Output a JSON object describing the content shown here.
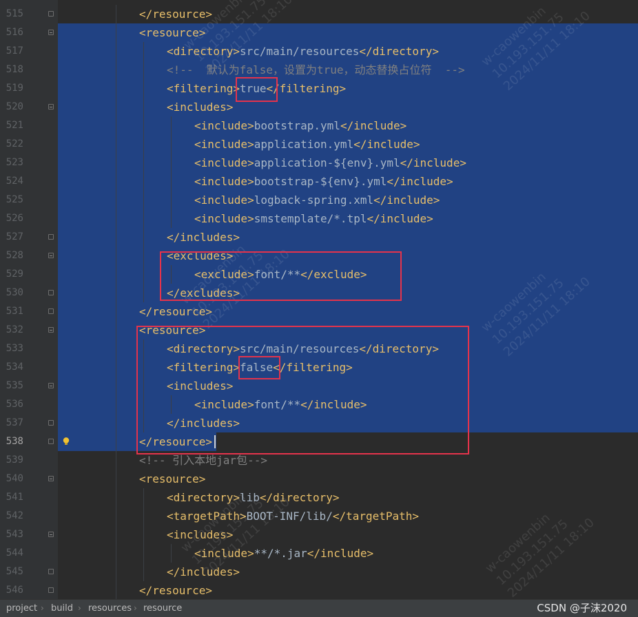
{
  "editor": {
    "lines": [
      {
        "num": "515",
        "indent": 3,
        "parts": [
          [
            "tag",
            "</resource>"
          ]
        ],
        "sel": false,
        "fold": "close"
      },
      {
        "num": "516",
        "indent": 3,
        "parts": [
          [
            "tag",
            "<resource>"
          ]
        ],
        "sel": true,
        "fold": "open"
      },
      {
        "num": "517",
        "indent": 4,
        "parts": [
          [
            "tag",
            "<directory>"
          ],
          [
            "txt",
            "src/main/resources"
          ],
          [
            "tag",
            "</directory>"
          ]
        ],
        "sel": true
      },
      {
        "num": "518",
        "indent": 4,
        "parts": [
          [
            "cmt",
            "<!--  默认为false，设置为true，动态替换占位符  -->"
          ]
        ],
        "sel": true
      },
      {
        "num": "519",
        "indent": 4,
        "parts": [
          [
            "tag",
            "<filtering>"
          ],
          [
            "txt",
            "true"
          ],
          [
            "tag",
            "</filtering>"
          ]
        ],
        "sel": true
      },
      {
        "num": "520",
        "indent": 4,
        "parts": [
          [
            "tag",
            "<includes>"
          ]
        ],
        "sel": true,
        "fold": "open"
      },
      {
        "num": "521",
        "indent": 5,
        "parts": [
          [
            "tag",
            "<include>"
          ],
          [
            "txt",
            "bootstrap.yml"
          ],
          [
            "tag",
            "</include>"
          ]
        ],
        "sel": true
      },
      {
        "num": "522",
        "indent": 5,
        "parts": [
          [
            "tag",
            "<include>"
          ],
          [
            "txt",
            "application.yml"
          ],
          [
            "tag",
            "</include>"
          ]
        ],
        "sel": true
      },
      {
        "num": "523",
        "indent": 5,
        "parts": [
          [
            "tag",
            "<include>"
          ],
          [
            "txt",
            "application-${env}.yml"
          ],
          [
            "tag",
            "</include>"
          ]
        ],
        "sel": true
      },
      {
        "num": "524",
        "indent": 5,
        "parts": [
          [
            "tag",
            "<include>"
          ],
          [
            "txt",
            "bootstrap-${env}.yml"
          ],
          [
            "tag",
            "</include>"
          ]
        ],
        "sel": true
      },
      {
        "num": "525",
        "indent": 5,
        "parts": [
          [
            "tag",
            "<include>"
          ],
          [
            "txt",
            "logback-spring.xml"
          ],
          [
            "tag",
            "</include>"
          ]
        ],
        "sel": true
      },
      {
        "num": "526",
        "indent": 5,
        "parts": [
          [
            "tag",
            "<include>"
          ],
          [
            "txt",
            "smstemplate/*.tpl"
          ],
          [
            "tag",
            "</include>"
          ]
        ],
        "sel": true
      },
      {
        "num": "527",
        "indent": 4,
        "parts": [
          [
            "tag",
            "</includes>"
          ]
        ],
        "sel": true,
        "fold": "close"
      },
      {
        "num": "528",
        "indent": 4,
        "parts": [
          [
            "tag",
            "<excludes>"
          ]
        ],
        "sel": true,
        "fold": "open"
      },
      {
        "num": "529",
        "indent": 5,
        "parts": [
          [
            "tag",
            "<exclude>"
          ],
          [
            "txt",
            "font/**"
          ],
          [
            "tag",
            "</exclude>"
          ]
        ],
        "sel": true
      },
      {
        "num": "530",
        "indent": 4,
        "parts": [
          [
            "tag",
            "</excludes>"
          ]
        ],
        "sel": true,
        "fold": "close"
      },
      {
        "num": "531",
        "indent": 3,
        "parts": [
          [
            "tag",
            "</resource>"
          ]
        ],
        "sel": true,
        "fold": "close"
      },
      {
        "num": "532",
        "indent": 3,
        "parts": [
          [
            "tag",
            "<resource>"
          ]
        ],
        "sel": true,
        "fold": "open"
      },
      {
        "num": "533",
        "indent": 4,
        "parts": [
          [
            "tag",
            "<directory>"
          ],
          [
            "txt",
            "src/main/resources"
          ],
          [
            "tag",
            "</directory>"
          ]
        ],
        "sel": true
      },
      {
        "num": "534",
        "indent": 4,
        "parts": [
          [
            "tag",
            "<filtering>"
          ],
          [
            "txt",
            "false"
          ],
          [
            "tag",
            "</filtering>"
          ]
        ],
        "sel": true
      },
      {
        "num": "535",
        "indent": 4,
        "parts": [
          [
            "tag",
            "<includes>"
          ]
        ],
        "sel": true,
        "fold": "open"
      },
      {
        "num": "536",
        "indent": 5,
        "parts": [
          [
            "tag",
            "<include>"
          ],
          [
            "txt",
            "font/**"
          ],
          [
            "tag",
            "</include>"
          ]
        ],
        "sel": true
      },
      {
        "num": "537",
        "indent": 4,
        "parts": [
          [
            "tag",
            "</includes>"
          ]
        ],
        "sel": true,
        "fold": "close"
      },
      {
        "num": "538",
        "indent": 3,
        "parts": [
          [
            "tag",
            "</resource>"
          ]
        ],
        "sel": "partial",
        "fold": "close",
        "active": true,
        "bulb": true
      },
      {
        "num": "539",
        "indent": 3,
        "parts": [
          [
            "cmt",
            "<!-- 引入本地jar包-->"
          ]
        ],
        "sel": false
      },
      {
        "num": "540",
        "indent": 3,
        "parts": [
          [
            "tag",
            "<resource>"
          ]
        ],
        "sel": false,
        "fold": "open"
      },
      {
        "num": "541",
        "indent": 4,
        "parts": [
          [
            "tag",
            "<directory>"
          ],
          [
            "txt",
            "lib"
          ],
          [
            "tag",
            "</directory>"
          ]
        ],
        "sel": false
      },
      {
        "num": "542",
        "indent": 4,
        "parts": [
          [
            "tag",
            "<targetPath>"
          ],
          [
            "txt",
            "BOOT-INF/lib/"
          ],
          [
            "tag",
            "</targetPath>"
          ]
        ],
        "sel": false
      },
      {
        "num": "543",
        "indent": 4,
        "parts": [
          [
            "tag",
            "<includes>"
          ]
        ],
        "sel": false,
        "fold": "open"
      },
      {
        "num": "544",
        "indent": 5,
        "parts": [
          [
            "tag",
            "<include>"
          ],
          [
            "txt",
            "**/*.jar"
          ],
          [
            "tag",
            "</include>"
          ]
        ],
        "sel": false
      },
      {
        "num": "545",
        "indent": 4,
        "parts": [
          [
            "tag",
            "</includes>"
          ]
        ],
        "sel": false,
        "fold": "close"
      },
      {
        "num": "546",
        "indent": 3,
        "parts": [
          [
            "tag",
            "</resource>"
          ]
        ],
        "sel": false,
        "fold": "close"
      }
    ]
  },
  "watermark": {
    "lines": [
      "w-caowenbin",
      "10.193.151.75",
      "2024/11/11 18:10"
    ]
  },
  "statusbar": {
    "breadcrumbs": [
      "project",
      "build",
      "resources",
      "resource"
    ],
    "credit": "CSDN @子沫2020"
  },
  "colors": {
    "selection": "#214283",
    "highlight_box": "#e5334b",
    "tag": "#e8bf6a",
    "text": "#a9b7c6",
    "comment": "#808080"
  }
}
